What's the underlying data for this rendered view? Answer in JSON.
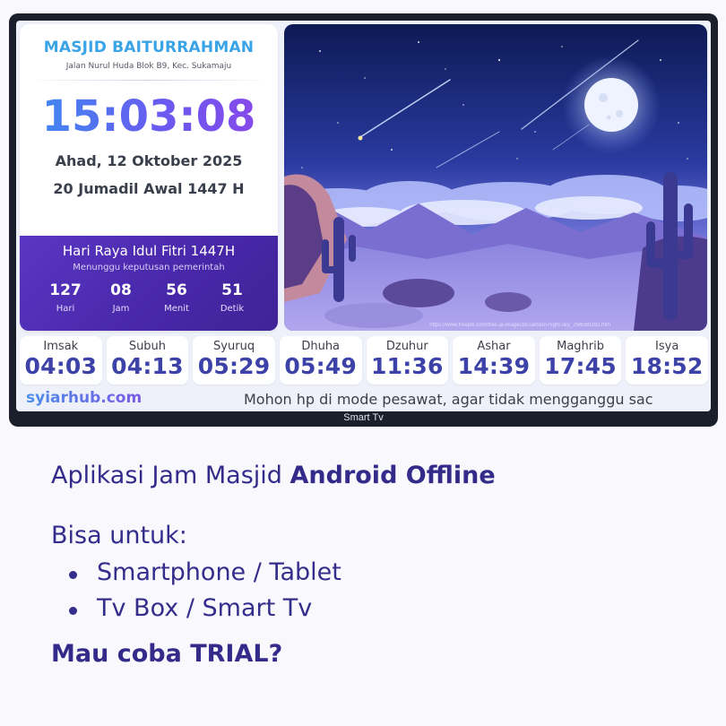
{
  "device_label": "Smart Tv",
  "mosque": {
    "name": "MASJID BAITURRAHMAN",
    "address": "Jalan Nurul Huda Blok B9, Kec. Sukamaju"
  },
  "clock": "15:03:08",
  "date_gregorian": "Ahad, 12 Oktober 2025",
  "date_hijri": "20 Jumadil Awal 1447 H",
  "event": {
    "title": "Hari Raya Idul Fitri 1447H",
    "subtitle": "Menunggu keputusan pemerintah",
    "countdown": [
      {
        "value": "127",
        "label": "Hari"
      },
      {
        "value": "08",
        "label": "Jam"
      },
      {
        "value": "56",
        "label": "Menit"
      },
      {
        "value": "51",
        "label": "Detik"
      }
    ]
  },
  "image_credit": "https://www.freepik.com/free-ai-image/3d-cartoon-night-sky_266560292.htm",
  "prayers": [
    {
      "name": "Imsak",
      "time": "04:03"
    },
    {
      "name": "Subuh",
      "time": "04:13"
    },
    {
      "name": "Syuruq",
      "time": "05:29"
    },
    {
      "name": "Dhuha",
      "time": "05:49"
    },
    {
      "name": "Dzuhur",
      "time": "11:36"
    },
    {
      "name": "Ashar",
      "time": "14:39"
    },
    {
      "name": "Maghrib",
      "time": "17:45"
    },
    {
      "name": "Isya",
      "time": "18:52"
    }
  ],
  "footer": {
    "brand": "syiarhub.com",
    "ticker": "Mohon hp di mode pesawat, agar tidak mengganggu sac"
  },
  "promo": {
    "title_plain": "Aplikasi Jam Masjid ",
    "title_bold": "Android Offline",
    "subtitle": "Bisa untuk:",
    "items": [
      "Smartphone / Tablet",
      "Tv Box / Smart Tv"
    ],
    "cta": "Mau coba TRIAL?"
  }
}
